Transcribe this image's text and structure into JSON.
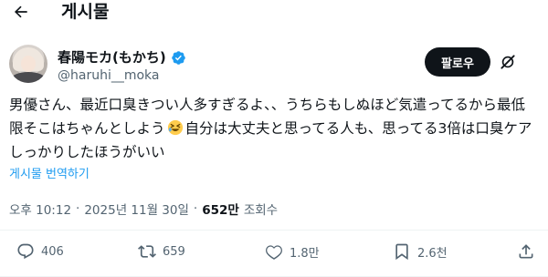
{
  "header": {
    "title": "게시물"
  },
  "author": {
    "display_name": "春陽モカ(もかち)",
    "handle": "@haruhi__moka",
    "verified": true
  },
  "follow_button": {
    "label": "팔로우"
  },
  "tweet": {
    "text_before_emoji": "男優さん、最近口臭きつい人多すぎるよ、、うちらもしぬほど気遣ってるから最低限そこはちゃんとしよう",
    "emoji": "laughing-squint-face",
    "text_after_emoji": "自分は大丈夫と思ってる人も、思ってる3倍は口臭ケアしっかりしたほうがいい"
  },
  "translate": {
    "label": "게시물 번역하기"
  },
  "meta": {
    "time": "오후 10:12",
    "separator": "·",
    "date": "2025년 11월 30일",
    "views_count": "652만",
    "views_label": "조회수"
  },
  "actions": {
    "reply_count": "406",
    "repost_count": "659",
    "like_count": "1.8만",
    "bookmark_count": "2.6천"
  },
  "colors": {
    "text": "#0f1419",
    "secondary": "#536471",
    "link": "#1d9bf0",
    "follow_bg": "#0f1419",
    "verified": "#1d9bf0"
  }
}
